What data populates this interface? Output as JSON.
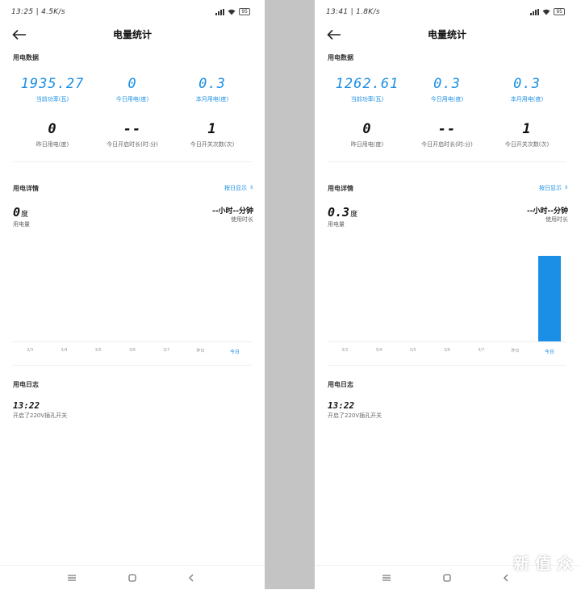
{
  "left": {
    "status": {
      "time_speed": "13:25 | 4.5K/s",
      "battery": "95"
    },
    "title": "电量统计",
    "section_data": "用电数据",
    "stats": [
      {
        "value": "1935.27",
        "label": "当前功率(瓦)"
      },
      {
        "value": "0",
        "label": "今日用电(度)"
      },
      {
        "value": "0.3",
        "label": "本月用电(度)"
      },
      {
        "value": "0",
        "label": "昨日用电(度)"
      },
      {
        "value": "--",
        "label": "今日开启时长(时:分)"
      },
      {
        "value": "1",
        "label": "今日开关次数(次)"
      }
    ],
    "section_detail": "用电详情",
    "mode": "按日显示",
    "usage_value": "0",
    "usage_unit": "度",
    "usage_label": "用电量",
    "duration_value": "--小时--分钟",
    "duration_label": "使用时长",
    "section_log": "用电日志",
    "log": {
      "time": "13:22",
      "text": "开启了220V插孔开关"
    }
  },
  "right": {
    "status": {
      "time_speed": "13:41 | 1.8K/s",
      "battery": "95"
    },
    "title": "电量统计",
    "section_data": "用电数据",
    "stats": [
      {
        "value": "1262.61",
        "label": "当前功率(瓦)"
      },
      {
        "value": "0.3",
        "label": "今日用电(度)"
      },
      {
        "value": "0.3",
        "label": "本月用电(度)"
      },
      {
        "value": "0",
        "label": "昨日用电(度)"
      },
      {
        "value": "--",
        "label": "今日开启时长(时:分)"
      },
      {
        "value": "1",
        "label": "今日开关次数(次)"
      }
    ],
    "section_detail": "用电详情",
    "mode": "按日显示",
    "usage_value": "0.3",
    "usage_unit": "度",
    "usage_label": "用电量",
    "duration_value": "--小时--分钟",
    "duration_label": "使用时长",
    "section_log": "用电日志",
    "log": {
      "time": "13:22",
      "text": "开启了220V插孔开关"
    }
  },
  "chart_data": [
    {
      "type": "bar",
      "categories": [
        "3/3",
        "3/4",
        "3/5",
        "3/6",
        "3/7",
        "昨日",
        "今日"
      ],
      "values": [
        0,
        0,
        0,
        0,
        0,
        0,
        0
      ],
      "ylim": [
        0,
        0.3
      ]
    },
    {
      "type": "bar",
      "categories": [
        "3/3",
        "3/4",
        "3/5",
        "3/6",
        "3/7",
        "昨日",
        "今日"
      ],
      "values": [
        0,
        0,
        0,
        0,
        0,
        0,
        0.3
      ],
      "ylim": [
        0,
        0.3
      ]
    }
  ],
  "watermark": "新 值 众"
}
